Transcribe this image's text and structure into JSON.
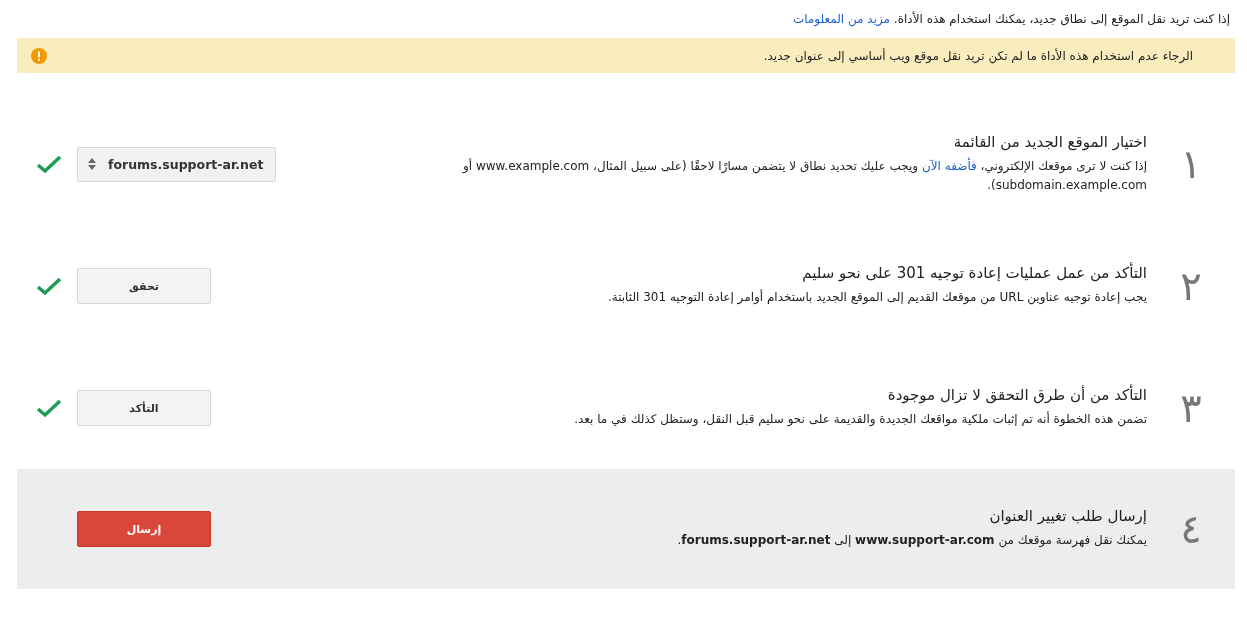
{
  "intro": {
    "text": "إذا كنت تريد نقل الموقع إلى نطاق جديد، يمكنك استخدام هذه الأداة.",
    "link": "مزيد من المعلومات"
  },
  "warning": {
    "text": "الرجاء عدم استخدام هذه الأداة ما لم تكن تريد نقل موقع ويب أساسي إلى عنوان جديد."
  },
  "steps": [
    {
      "number": "١",
      "title": "اختيار الموقع الجديد من القائمة",
      "description": [
        {
          "kind": "text",
          "text": "إذا كنت لا ترى موقعك الإلكتروني، "
        },
        {
          "kind": "link",
          "text": "فأضفه الآن"
        },
        {
          "kind": "text",
          "text": " ويجب عليك تحديد نطاق لا يتضمن مسارًا لاحقًا (على سبيل المثال، www.example.com أو subdomain.example.com)."
        }
      ],
      "control": {
        "kind": "select",
        "label": "forums.support-ar.net"
      },
      "done": true,
      "highlighted": false
    },
    {
      "number": "٢",
      "title": "التأكد من عمل عمليات إعادة توجيه 301 على نحو سليم",
      "description": [
        {
          "kind": "text",
          "text": "يجب إعادة توجيه عناوين URL من موقعك القديم إلى الموقع الجديد باستخدام أوامر إعادة التوجيه 301 الثابتة."
        }
      ],
      "control": {
        "kind": "button",
        "label": "تحقق"
      },
      "done": true,
      "highlighted": false
    },
    {
      "number": "٣",
      "title": "التأكد من أن طرق التحقق لا تزال موجودة",
      "description": [
        {
          "kind": "text",
          "text": "تضمن هذه الخطوة أنه تم إثبات ملكية مواقعك الجديدة والقديمة على نحو سليم قبل النقل، وستظل كذلك في ما بعد."
        }
      ],
      "control": {
        "kind": "button",
        "label": "التأكد"
      },
      "done": true,
      "highlighted": false
    },
    {
      "number": "٤",
      "title": "إرسال طلب تغيير العنوان",
      "description": [
        {
          "kind": "text",
          "text": "يمكنك نقل فهرسة موقعك من **www.support-ar.com** إلى **forums.support-ar.net**."
        }
      ],
      "control": {
        "kind": "primary",
        "label": "إرسال"
      },
      "done": false,
      "highlighted": true
    }
  ]
}
